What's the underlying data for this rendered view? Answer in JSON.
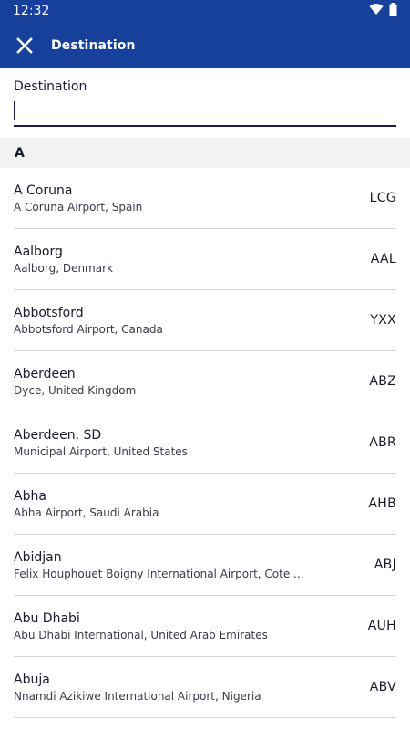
{
  "status_bar": {
    "time": "12:32",
    "icons": [
      "wifi-icon",
      "battery-icon"
    ]
  },
  "app_bar": {
    "title": "Destination",
    "close_icon": "close-icon"
  },
  "search": {
    "label": "Destination",
    "value": ""
  },
  "section": {
    "letter": "A"
  },
  "destinations": [
    {
      "city": "A Coruna",
      "airport": "A Coruna Airport, Spain",
      "code": "LCG"
    },
    {
      "city": "Aalborg",
      "airport": "Aalborg, Denmark",
      "code": "AAL"
    },
    {
      "city": "Abbotsford",
      "airport": "Abbotsford Airport, Canada",
      "code": "YXX"
    },
    {
      "city": "Aberdeen",
      "airport": "Dyce, United Kingdom",
      "code": "ABZ"
    },
    {
      "city": "Aberdeen, SD",
      "airport": "Municipal Airport, United States",
      "code": "ABR"
    },
    {
      "city": "Abha",
      "airport": "Abha Airport, Saudi Arabia",
      "code": "AHB"
    },
    {
      "city": "Abidjan",
      "airport": "Felix Houphouet Boigny International Airport, Cote ...",
      "code": "ABJ"
    },
    {
      "city": "Abu Dhabi",
      "airport": "Abu Dhabi International, United Arab Emirates",
      "code": "AUH"
    },
    {
      "city": "Abuja",
      "airport": "Nnamdi Azikiwe International Airport, Nigeria",
      "code": "ABV"
    }
  ],
  "colors": {
    "brand": "#16409a",
    "section_bg": "#f2f2f2",
    "divider": "#d6d6d6"
  }
}
